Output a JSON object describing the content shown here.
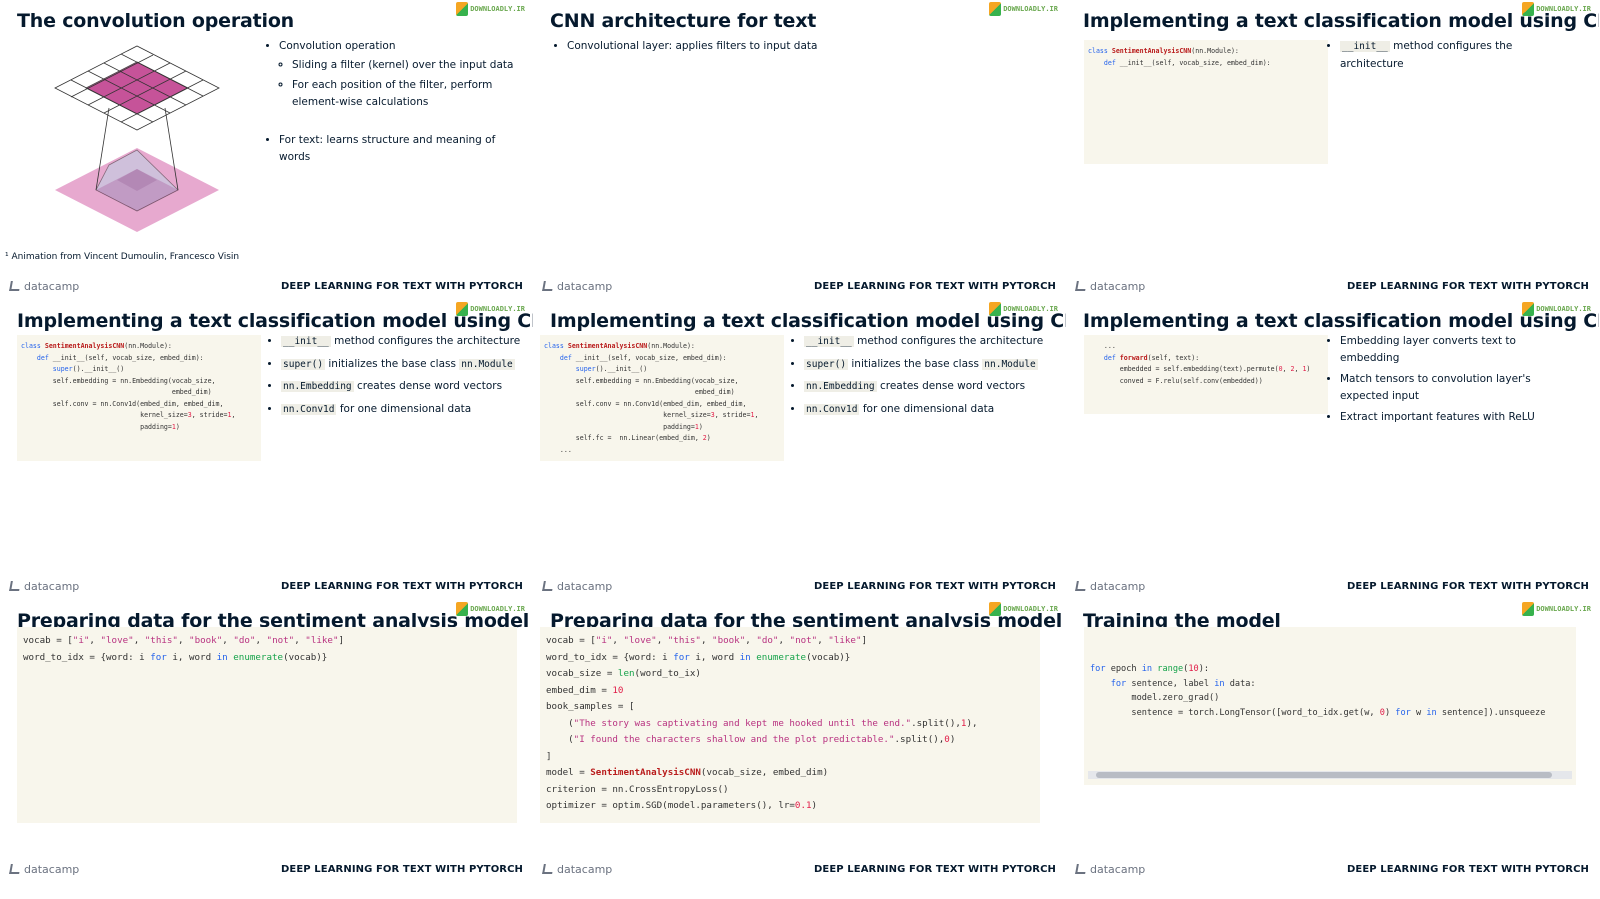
{
  "footer": {
    "brand": "datacamp",
    "course": "DEEP LEARNING FOR TEXT WITH PYTORCH"
  },
  "logo_text": "DOWNLOADLY.IR",
  "slides": [
    {
      "title": "The convolution operation",
      "bullets": [
        "Convolution operation",
        "For text: learns structure and meaning of words"
      ],
      "subbullets": [
        "Sliding a filter (kernel) over the input data",
        "For each position of the filter, perform element-wise calculations"
      ],
      "footnote": "¹ Animation from Vincent Dumoulin, Francesco Visin"
    },
    {
      "title": "CNN architecture for text",
      "bullets": [
        "Convolutional layer: applies filters to input data"
      ]
    },
    {
      "title": "Implementing a text classification model using CNN",
      "bullets": [
        {
          "code": "__init__",
          "text": " method configures the architecture"
        }
      ]
    },
    {
      "title": "Implementing a text classification model using CNN",
      "bullets": [
        {
          "code": "__init__",
          "text": " method configures the architecture"
        },
        {
          "code": "super()",
          "text": " initializes the base class ",
          "code2": "nn.Module"
        },
        {
          "code": "nn.Embedding",
          "text": " creates dense word vectors"
        },
        {
          "code": "nn.Conv1d",
          "text": " for one dimensional data"
        }
      ]
    },
    {
      "title": "Implementing a text classification model using CNN",
      "bullets": [
        {
          "code": "__init__",
          "text": " method configures the architecture"
        },
        {
          "code": "super()",
          "text": " initializes the base class ",
          "code2": "nn.Module"
        },
        {
          "code": "nn.Embedding",
          "text": " creates dense word vectors"
        },
        {
          "code": "nn.Conv1d",
          "text": " for one dimensional data"
        }
      ]
    },
    {
      "title": "Implementing a text classification model using CNN",
      "bullets": [
        "Embedding layer converts text to embedding",
        "Match tensors to convolution layer's expected input",
        "Extract important features with ReLU"
      ]
    },
    {
      "title": "Preparing data for the sentiment analysis model"
    },
    {
      "title": "Preparing data for the sentiment analysis model"
    },
    {
      "title": "Training the model"
    }
  ],
  "code": {
    "init_short": [
      "class SentimentAnalysisCNN(nn.Module):",
      "    def __init__(self, vocab_size, embed_dim):"
    ],
    "init_full": [
      "class SentimentAnalysisCNN(nn.Module):",
      "    def __init__(self, vocab_size, embed_dim):",
      "        super().__init__()",
      "        self.embedding = nn.Embedding(vocab_size,",
      "                                      embed_dim)",
      "        self.conv = nn.Conv1d(embed_dim, embed_dim,",
      "                              kernel_size=3, stride=1,",
      "                              padding=1)"
    ],
    "init_fc": [
      "        self.fc =  nn.Linear(embed_dim, 2)",
      "    ..."
    ],
    "forward": [
      "    ...",
      "    def forward(self, text):",
      "        embedded = self.embedding(text).permute(0, 2, 1)",
      "        conved = F.relu(self.conv(embedded))"
    ],
    "vocab": [
      "vocab = [\"i\", \"love\", \"this\", \"book\", \"do\", \"not\", \"like\"]",
      "word_to_idx = {word: i for i, word in enumerate(vocab)}"
    ],
    "prep": [
      "vocab_size = len(word_to_ix)",
      "embed_dim = 10",
      "book_samples = [",
      "    (\"The story was captivating and kept me hooked until the end.\".split(),1),",
      "    (\"I found the characters shallow and the plot predictable.\".split(),0)",
      "]",
      "model = SentimentAnalysisCNN(vocab_size, embed_dim)",
      "criterion = nn.CrossEntropyLoss()",
      "optimizer = optim.SGD(model.parameters(), lr=0.1)"
    ],
    "train": [
      "for epoch in range(10):",
      "    for sentence, label in data:",
      "        model.zero_grad()",
      "        sentence = torch.LongTensor([word_to_idx.get(w, 0) for w in sentence]).unsqueeze"
    ]
  }
}
